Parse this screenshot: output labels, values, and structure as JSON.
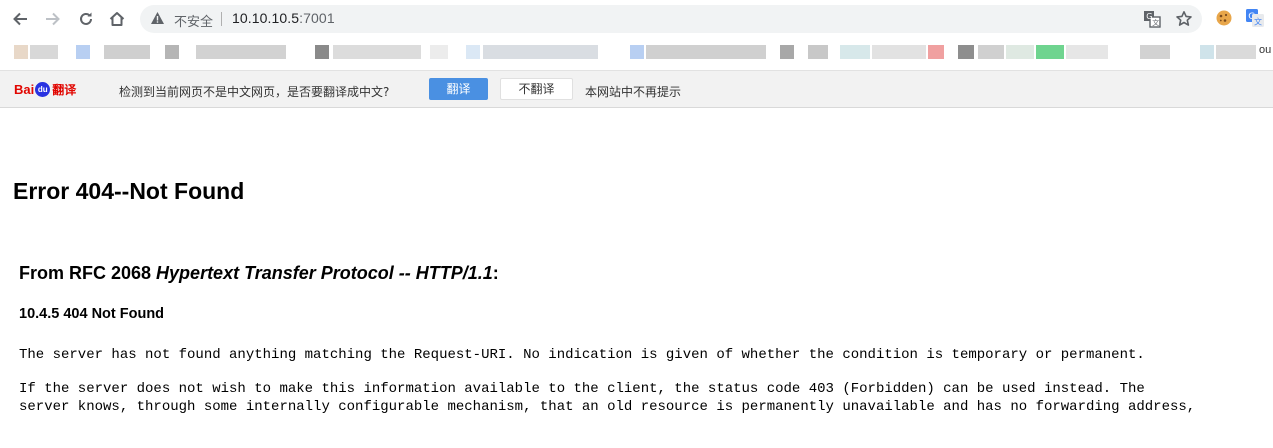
{
  "browser": {
    "security_label": "不安全",
    "url_host": "10.10.10.5",
    "url_port": ":7001",
    "bookmark_partial_text": "ou"
  },
  "translate_bar": {
    "logo_bai": "Bai",
    "logo_du": "du",
    "logo_fanyi": "翻译",
    "message": "检测到当前网页不是中文网页，是否要翻译成中文?",
    "translate_button": "翻译",
    "dont_translate_button": "不翻译",
    "never_link": "本网站中不再提示"
  },
  "page": {
    "title": "Error 404--Not Found",
    "rfc_prefix": "From RFC 2068 ",
    "rfc_title": "Hypertext Transfer Protocol -- HTTP/1.1",
    "rfc_suffix": ":",
    "section_heading": "10.4.5 404 Not Found",
    "paragraph1": "The server has not found anything matching the Request-URI. No indication is given of whether the condition is temporary or permanent.",
    "paragraph2": "If the server does not wish to make this information available to the client, the status code 403 (Forbidden) can be used instead. The\nserver knows, through some internally configurable mechanism, that an old resource is permanently unavailable and has no forwarding address,"
  },
  "colors": {
    "translate_button": "#4a90e2",
    "baidu_red": "#e10601",
    "baidu_blue": "#2932e1"
  },
  "icons": [
    "back-arrow-icon",
    "forward-arrow-icon",
    "reload-icon",
    "home-icon",
    "warning-triangle-icon",
    "translate-page-icon",
    "star-icon",
    "cookie-extension-icon",
    "google-translate-extension-icon"
  ]
}
